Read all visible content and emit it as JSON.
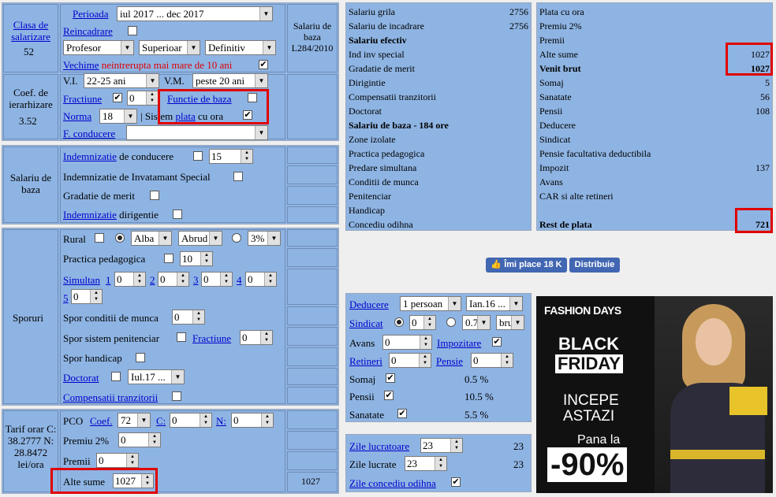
{
  "left": {
    "clasa_label": "Clasa de salarizare",
    "clasa_value": "52",
    "perioada_label": "Perioada",
    "perioada_value": "iul 2017 ... dec 2017",
    "reincadrare_label": "Reincadrare",
    "profesor": "Profesor",
    "superioara": "Superioar",
    "definitiv": "Definitiv",
    "vechime_label": "Vechime",
    "vechime_text": " neintrerupta mai mare de 10 ani",
    "salariu_baza_legea": "Salariu de baza L284/2010",
    "coef_label": "Coef. de ierarhizare",
    "coef_value": "3.52",
    "vi_label": "V.I.",
    "vi_value": "22-25 ani",
    "vm_label": "V.M.",
    "vm_value": "peste 20 ani",
    "fractiune_label": "Fractiune",
    "fractiune_value": "0",
    "functie_label": "Functie de baza",
    "norma_label": "Norma",
    "norma_value": "18",
    "sistem_pre": "| Sistem ",
    "sistem_link": "plata",
    "sistem_post": " cu ora",
    "fconducere_label": "F. conducere",
    "salariu_baza_label": "Salariu de baza",
    "ind_conducere_link": "Indemnizatie",
    "ind_conducere_text": " de conducere",
    "ind_conducere_value": "15",
    "ind_special": "Indemnizatie de Invatamant Special",
    "gradatie": "Gradatie de merit",
    "ind_dirig_link": "Indemnizatie",
    "ind_dirig_text": " dirigentie",
    "sporuri_label": "Sporuri",
    "rural": "Rural",
    "alba": "Alba",
    "abrud": "Abrud",
    "pct": "3%",
    "practica": "Practica pedagogica",
    "practica_value": "10",
    "simultan": "Simultan",
    "sim_nums": [
      "1",
      "2",
      "3",
      "4",
      "5"
    ],
    "sim_vals": [
      "0",
      "0",
      "0",
      "0",
      "0"
    ],
    "spor_conditii": "Spor conditii de munca",
    "spor_conditii_value": "0",
    "spor_sistem": "Spor sistem penitenciar",
    "spor_fractiune": "Fractiune",
    "spor_fractiune_value": "0",
    "spor_handicap": "Spor handicap",
    "doctorat": "Doctorat",
    "doctorat_value": "Iul.17 ...",
    "compensatii": "Compensatii tranzitorii",
    "tarif_label": "Tarif orar C: 38.2777 N: 28.8472 lei/ora",
    "pco": "PCO",
    "coef": "Coef.",
    "coef_val": "72",
    "c": "C:",
    "c_val": "0",
    "n": "N:",
    "n_val": "0",
    "premiu2": "Premiu 2%",
    "premiu2_val": "0",
    "premii": "Premii",
    "premii_val": "0",
    "alte_sume": "Alte sume",
    "alte_sume_val": "1027",
    "alte_sume_result": "1027"
  },
  "mid": [
    [
      "Salariu grila",
      "2756",
      false
    ],
    [
      "Salariu de incadrare",
      "2756",
      false
    ],
    [
      "Salariu efectiv",
      "",
      true
    ],
    [
      "Ind inv special",
      "",
      false
    ],
    [
      "Gradatie de merit",
      "",
      false
    ],
    [
      "Dirigintie",
      "",
      false
    ],
    [
      "Compensatii tranzitorii",
      "",
      false
    ],
    [
      "Doctorat",
      "",
      false
    ],
    [
      "Salariu de baza - 184 ore",
      "",
      true
    ],
    [
      "Zone izolate",
      "",
      false
    ],
    [
      "Practica pedagogica",
      "",
      false
    ],
    [
      "Predare simultana",
      "",
      false
    ],
    [
      "Conditii de munca",
      "",
      false
    ],
    [
      "Penitenciar",
      "",
      false
    ],
    [
      "Handicap",
      "",
      false
    ],
    [
      "Concediu odihna",
      "",
      false
    ]
  ],
  "right": [
    [
      "Plata cu ora",
      "",
      false
    ],
    [
      "Premiu 2%",
      "",
      false
    ],
    [
      "Premii",
      "",
      false
    ],
    [
      "Alte sume",
      "1027",
      false
    ],
    [
      "Venit brut",
      "1027",
      true
    ],
    [
      "Somaj",
      "5",
      false
    ],
    [
      "Sanatate",
      "56",
      false
    ],
    [
      "Pensii",
      "108",
      false
    ],
    [
      "Deducere",
      "",
      false
    ],
    [
      "Sindicat",
      "",
      false
    ],
    [
      "Pensie facultativa deductibila",
      "",
      false
    ],
    [
      "Impozit",
      "137",
      false
    ],
    [
      "Avans",
      "",
      false
    ],
    [
      "CAR si alte retineri",
      "",
      false
    ],
    [
      "",
      "",
      false
    ],
    [
      "Rest de plata",
      "721",
      true
    ]
  ],
  "social": {
    "like": "Îmi place 18 K",
    "share": "Distribuie"
  },
  "ded": {
    "deducere": "Deducere",
    "ded_val": "1 persoan",
    "ded_month": "Ian.16 ...",
    "sindicat": "Sindicat",
    "sind_val": "0",
    "sind_val2": "0.7",
    "sind_sel": "bru",
    "avans": "Avans",
    "avans_val": "0",
    "impozitare": "Impozitare",
    "retineri": "Retineri",
    "ret_val": "0",
    "pensie": "Pensie",
    "pensie_val": "0",
    "somaj": "Somaj",
    "somaj_pct": "0.5 %",
    "pensii": "Pensii",
    "pensii_pct": "10.5 %",
    "sanatate": "Sanatate",
    "sanatate_pct": "5.5 %"
  },
  "zile": {
    "zile_lucratoare": "Zile lucratoare",
    "zl_val": "23",
    "zl_res": "23",
    "zile_lucrate": "Zile lucrate",
    "zlc_val": "23",
    "zlc_res": "23",
    "zile_concediu": "Zile concediu odihna"
  },
  "ad": {
    "brand": "FASHION DAYS",
    "l1": "BLACK",
    "l2": "FRIDAY",
    "l3": "INCEPE",
    "l4": "ASTAZI",
    "l5": "Pana la",
    "l6": "-90%"
  },
  "colors": {
    "panel": "#8eb4e3",
    "highlight": "#e00000",
    "fb": "#4267b2",
    "ad_bg": "#111111"
  }
}
